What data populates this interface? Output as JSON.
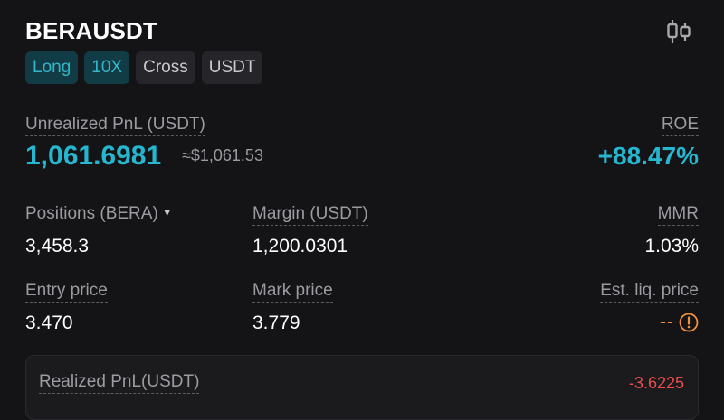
{
  "header": {
    "symbol": "BERAUSDT",
    "chart_icon": "candlestick-chart-icon",
    "tags": [
      "Long",
      "10X",
      "Cross",
      "USDT"
    ]
  },
  "pnl": {
    "label": "Unrealized PnL (USDT)",
    "value": "1,061.6981",
    "approx": "≈$1,061.53",
    "roe_label": "ROE",
    "roe_value": "+88.47%"
  },
  "stats": {
    "positions_label": "Positions (BERA)",
    "positions_value": "3,458.3",
    "margin_label": "Margin (USDT)",
    "margin_value": "1,200.0301",
    "mmr_label": "MMR",
    "mmr_value": "1.03%",
    "entry_label": "Entry price",
    "entry_value": "3.470",
    "mark_label": "Mark price",
    "mark_value": "3.779",
    "liq_label": "Est. liq. price",
    "liq_value": "--"
  },
  "realized": {
    "label": "Realized PnL(USDT)",
    "value": "-3.6225"
  },
  "colors": {
    "background": "#141416",
    "accent": "#25b6d0",
    "negative": "#ef4b4b",
    "warning": "#f0903a",
    "muted": "#9b9ba1"
  }
}
